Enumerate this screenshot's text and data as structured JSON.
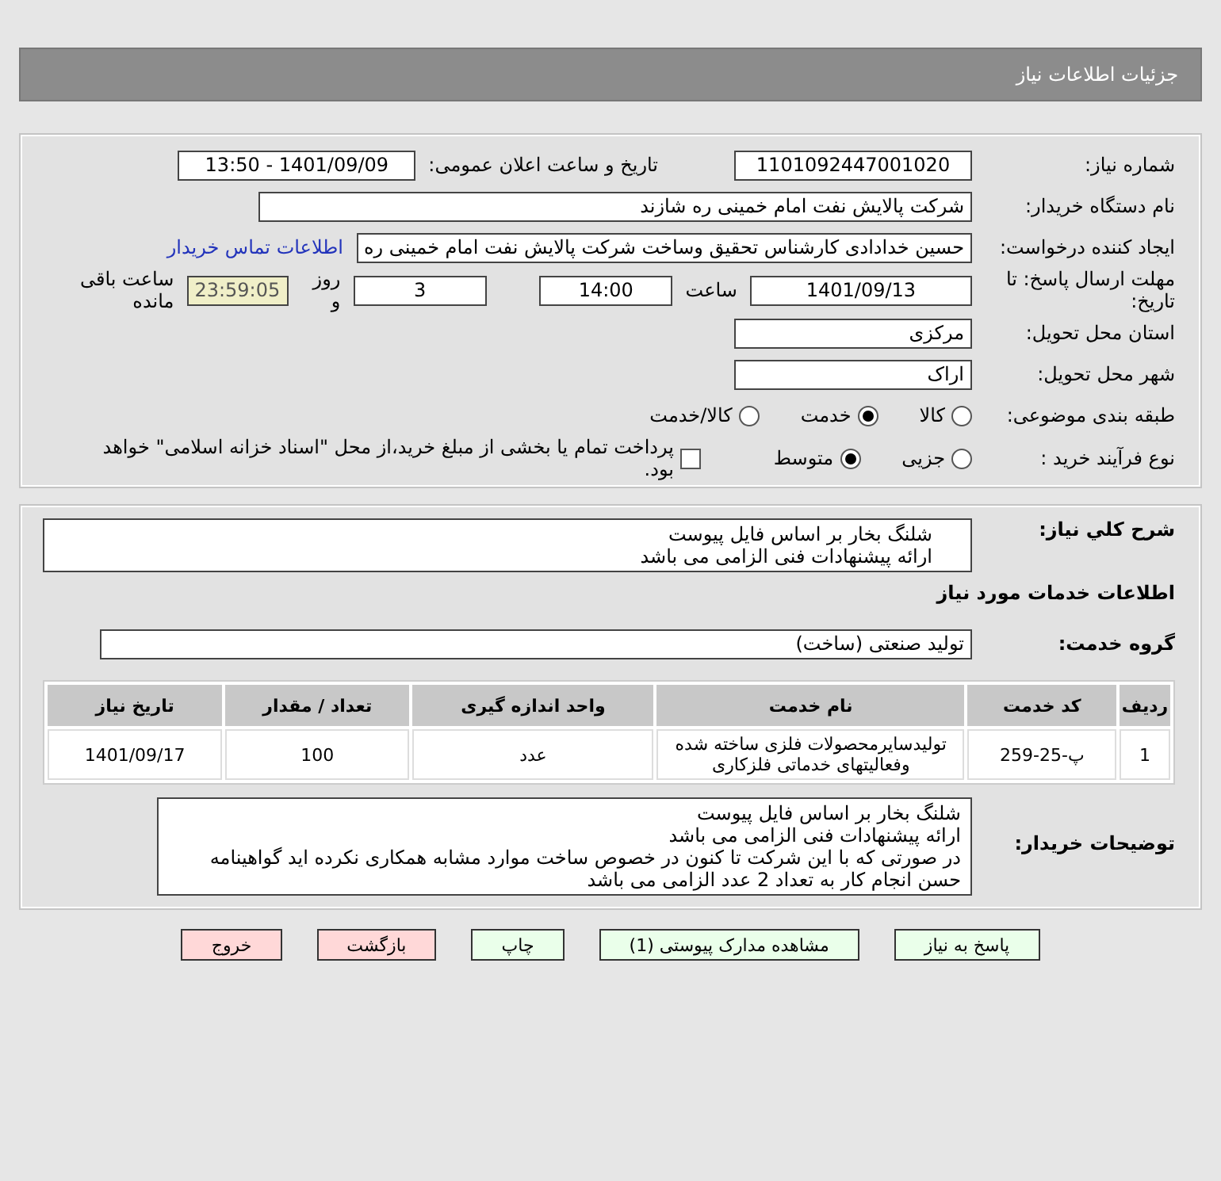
{
  "header": {
    "title": "جزئیات اطلاعات نیاز"
  },
  "need_number": {
    "label": "شماره نیاز:",
    "value": "1101092447001020"
  },
  "announce": {
    "label": "تاریخ و ساعت اعلان عمومی:",
    "value": "1401/09/09 - 13:50"
  },
  "buyer_org": {
    "label": "نام دستگاه خریدار:",
    "value": "شرکت پالایش نفت امام خمینی  ره  شازند"
  },
  "requester": {
    "label": "ایجاد کننده درخواست:",
    "value": "حسین خدادادی کارشناس تحقیق وساخت شرکت پالایش نفت امام خمینی  ره",
    "link": "اطلاعات تماس خریدار"
  },
  "deadline": {
    "label": "مهلت ارسال پاسخ: تا تاریخ:",
    "date": "1401/09/13",
    "time_label": "ساعت",
    "time": "14:00",
    "days": "3",
    "days_label": "روز و",
    "remaining": "23:59:05",
    "remaining_label": "ساعت باقی مانده"
  },
  "province": {
    "label": "استان محل تحویل:",
    "value": "مرکزی"
  },
  "city": {
    "label": "شهر محل تحویل:",
    "value": "اراک"
  },
  "category": {
    "label": "طبقه بندی موضوعی:",
    "options": [
      {
        "label": "کالا",
        "selected": false
      },
      {
        "label": "خدمت",
        "selected": true
      },
      {
        "label": "کالا/خدمت",
        "selected": false
      }
    ]
  },
  "purchase_type": {
    "label": "نوع فرآیند خرید :",
    "options": [
      {
        "label": "جزیی",
        "selected": false
      },
      {
        "label": "متوسط",
        "selected": true
      }
    ],
    "treasury": {
      "checked": false,
      "text": "پرداخت تمام یا بخشی از مبلغ خرید،از محل \"اسناد خزانه اسلامی\" خواهد بود."
    }
  },
  "summary": {
    "label": "شرح کلي نياز:",
    "lines": [
      "شلنگ بخار بر اساس فایل پیوست",
      "ارائه پیشنهادات فنی الزامی می باشد"
    ]
  },
  "services_heading": "اطلاعات خدمات مورد نیاز",
  "service_group": {
    "label": "گروه خدمت:",
    "value": "تولید صنعتی (ساخت)"
  },
  "table": {
    "columns": [
      "ردیف",
      "کد خدمت",
      "نام خدمت",
      "واحد اندازه گیری",
      "تعداد / مقدار",
      "تاریخ نیاز"
    ],
    "rows": [
      [
        "1",
        "پ-25-259",
        "تولیدسایرمحصولات فلزی ساخته شده وفعالیتهای خدماتی فلزکاری",
        "عدد",
        "100",
        "1401/09/17"
      ]
    ]
  },
  "buyer_notes": {
    "label": "توضیحات خریدار:",
    "lines": [
      "شلنگ بخار بر اساس فایل پیوست",
      "ارائه پیشنهادات فنی الزامی می باشد",
      "در صورتی که با این شرکت تا کنون در خصوص ساخت موارد مشابه همکاری نکرده اید گواهینامه حسن انجام کار به تعداد 2 عدد الزامی می باشد"
    ]
  },
  "buttons": [
    {
      "label": "پاسخ به نیاز",
      "kind": "primary"
    },
    {
      "label": "مشاهده مدارک پیوستی (1)",
      "kind": "primary"
    },
    {
      "label": "چاپ",
      "kind": "primary"
    },
    {
      "label": "بازگشت",
      "kind": "danger"
    },
    {
      "label": "خروج",
      "kind": "danger"
    }
  ]
}
